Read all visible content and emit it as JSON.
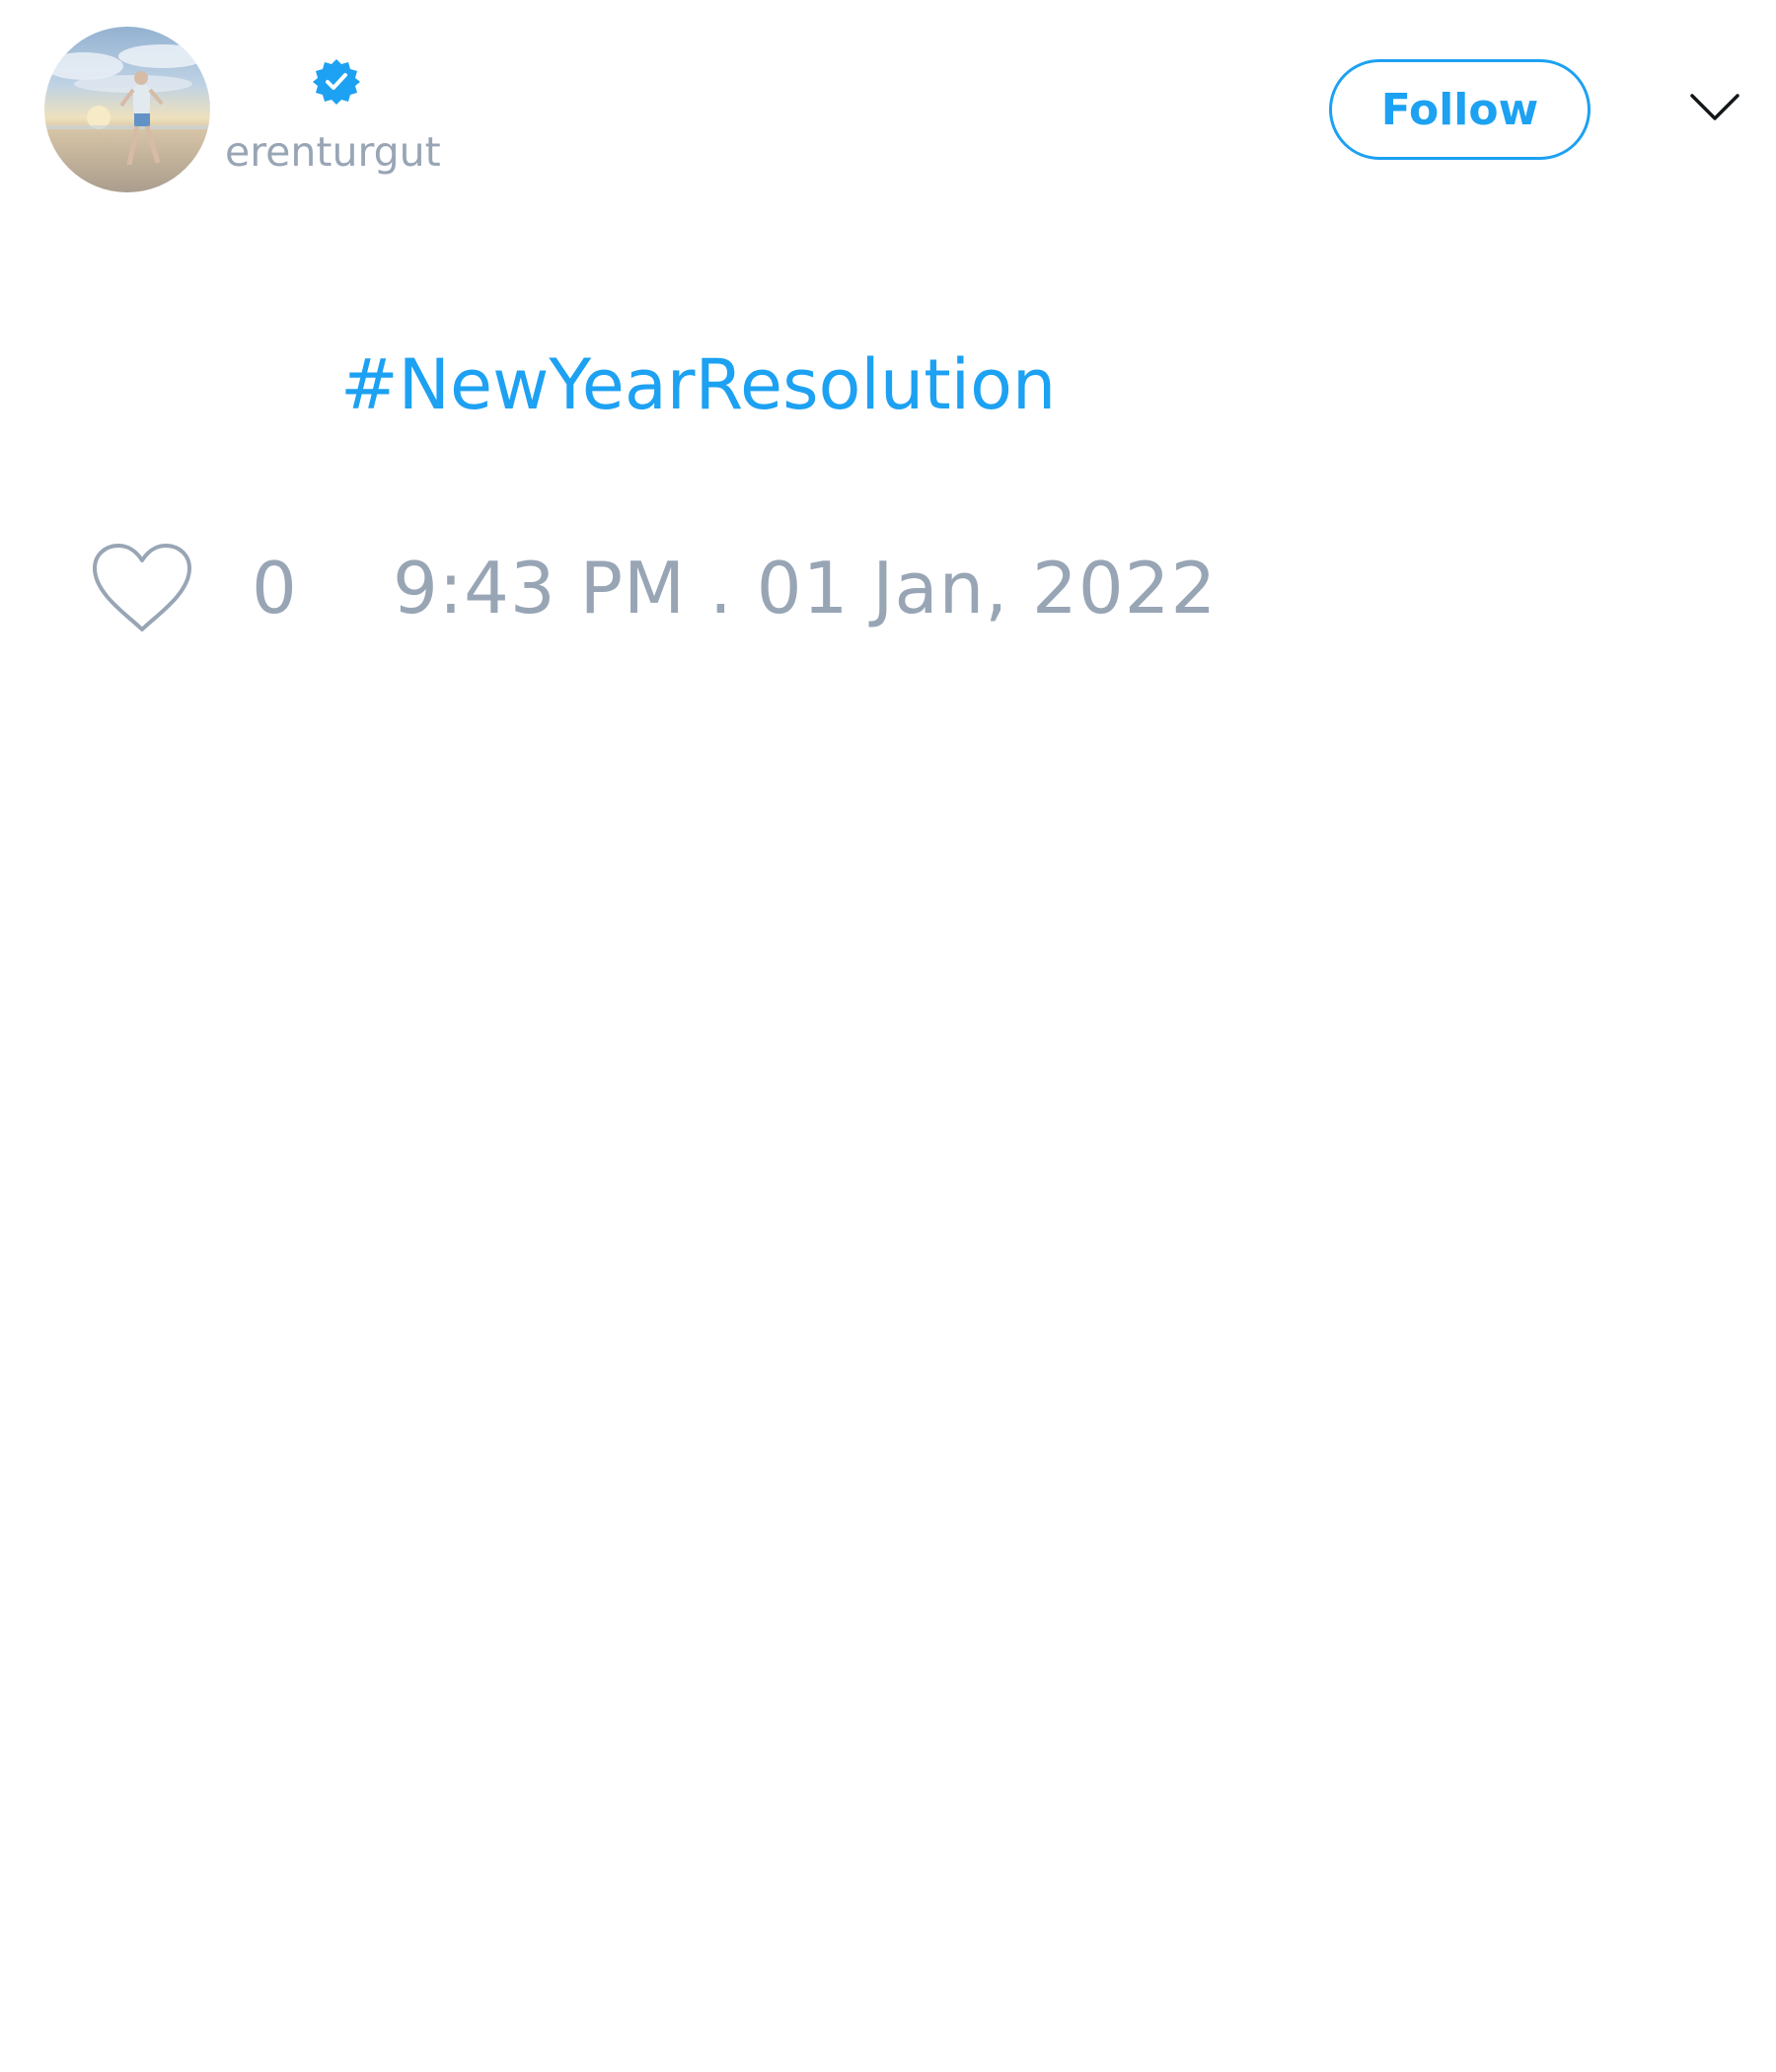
{
  "tweet": {
    "author": {
      "display_name": "",
      "username": "erenturgut",
      "verified": true,
      "avatar": "beach-photo-avatar"
    },
    "follow_button": {
      "label": "Follow"
    },
    "menu_icon": "chevron-down-icon",
    "text": "#NewYearResolution",
    "likes": {
      "icon": "heart-icon",
      "count": "0"
    },
    "timestamp": "9:43 PM . 01 Jan, 2022"
  },
  "colors": {
    "accent": "#1da1f2",
    "muted_text": "#98a5b5",
    "background": "#ffffff"
  }
}
